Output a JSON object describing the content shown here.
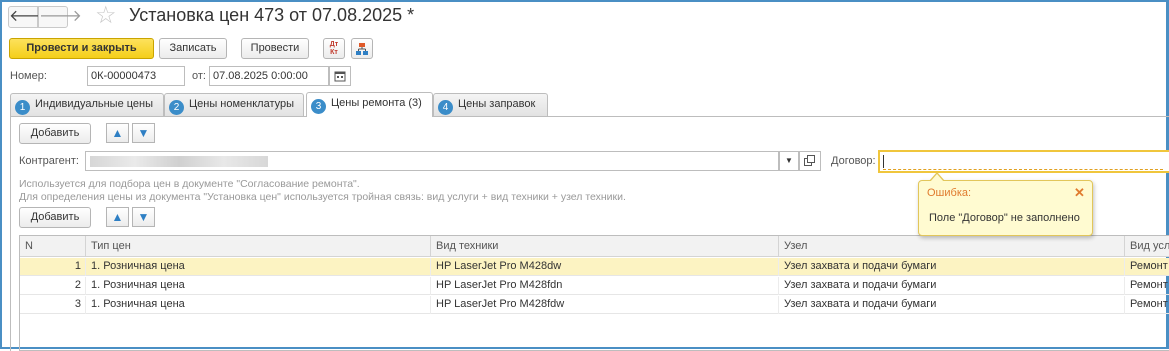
{
  "window": {
    "title": "Установка цен 473 от 07.08.2025 *"
  },
  "nav": {
    "back_glyph": "🡐",
    "forward_glyph": "🡒",
    "favorite_icon": "star-icon"
  },
  "toolbar": {
    "post_close_label": "Провести и закрыть",
    "save_label": "Записать",
    "post_label": "Провести",
    "dtkt_icon": "Дт/Кт",
    "dtkt_top": "Дт",
    "dtkt_bottom": "Кт"
  },
  "header": {
    "number_label": "Номер:",
    "number_value": "0К-00000473",
    "date_label": "от:",
    "date_value": "07.08.2025  0:00:00"
  },
  "tabs": [
    {
      "num": "1",
      "label": "Индивидуальные цены"
    },
    {
      "num": "2",
      "label": "Цены номенклатуры"
    },
    {
      "num": "3",
      "label": "Цены ремонта (3)"
    },
    {
      "num": "4",
      "label": "Цены заправок"
    }
  ],
  "panel": {
    "add_label_1": "Добавить",
    "add_label_2": "Добавить",
    "counterparty_label": "Контрагент:",
    "counterparty_value": "",
    "contract_label": "Договор:",
    "contract_value": "",
    "hint_line1": "Используется для подбора цен в документе \"Согласование ремонта\".",
    "hint_line2": "Для определения цены из документа \"Установка цен\" используется тройная связь: вид услуги + вид техники + узел техники."
  },
  "error_popup": {
    "title": "Ошибка:",
    "message": "Поле \"Договор\" не заполнено",
    "close_glyph": "✕"
  },
  "table": {
    "columns": [
      "N",
      "Тип цен",
      "Вид техники",
      "Узел",
      "Вид усл"
    ],
    "rows": [
      {
        "n": "1",
        "price_type": "1. Розничная цена",
        "equipment": "HP LaserJet Pro M428dw",
        "node": "Узел захвата и подачи бумаги",
        "service": "Ремонт"
      },
      {
        "n": "2",
        "price_type": "1. Розничная цена",
        "equipment": "HP LaserJet Pro M428fdn",
        "node": "Узел захвата и подачи бумаги",
        "service": "Ремонт"
      },
      {
        "n": "3",
        "price_type": "1. Розничная цена",
        "equipment": "HP LaserJet Pro M428fdw",
        "node": "Узел захвата и подачи бумаги",
        "service": "Ремонт"
      }
    ]
  },
  "colors": {
    "accent": "#3b8dc9",
    "primary_button": "#f4cf1a",
    "selected_row": "#fcf3c2",
    "error_bg": "#fffbd1",
    "error_close": "#e07b2e",
    "window_border": "#4a8fc4"
  }
}
